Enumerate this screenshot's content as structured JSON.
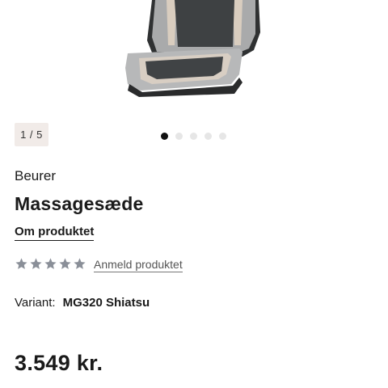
{
  "gallery": {
    "counter": "1 / 5",
    "dots_total": 5,
    "active_index": 0
  },
  "product": {
    "brand": "Beurer",
    "title": "Massagesæde",
    "about_link": "Om produktet",
    "rating": 0,
    "max_rating": 5,
    "review_link": "Anmeld produktet",
    "variant_label": "Variant:",
    "variant_value": "MG320 Shiatsu",
    "price": "3.549 kr."
  },
  "colors": {
    "star": "#8a8f98",
    "dot_active": "#111111",
    "dot_inactive": "#e6e6e6",
    "counter_bg": "#f1ebe8"
  },
  "icons": {
    "star": "star-icon"
  }
}
